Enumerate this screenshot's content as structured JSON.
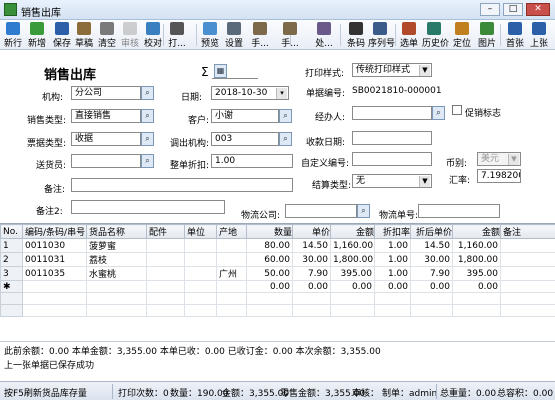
{
  "window": {
    "title": "销售出库",
    "btn_min": "–",
    "btn_max": "□",
    "btn_close": "✕"
  },
  "toolbar": [
    {
      "name": "new-row",
      "label": "新行",
      "icon": "new-row-icon"
    },
    {
      "name": "new",
      "label": "新增",
      "icon": "new-doc-icon"
    },
    {
      "name": "save",
      "label": "保存",
      "icon": "save-icon"
    },
    {
      "name": "draft",
      "label": "草稿",
      "icon": "draft-icon"
    },
    {
      "name": "clear",
      "label": "清空",
      "icon": "clear-icon"
    },
    {
      "name": "audit",
      "label": "审核",
      "icon": "audit-icon",
      "disabled": true
    },
    {
      "name": "proof",
      "label": "校对",
      "icon": "proof-icon"
    },
    {
      "name": "print",
      "label": "打...",
      "icon": "print-icon"
    },
    {
      "name": "preview",
      "label": "预览",
      "icon": "preview-icon"
    },
    {
      "name": "settings",
      "label": "设置",
      "icon": "settings-icon"
    },
    {
      "name": "hand",
      "label": "手...",
      "icon": "hand-icon"
    },
    {
      "name": "hand2",
      "label": "手...",
      "icon": "hand2-icon"
    },
    {
      "name": "process",
      "label": "处...",
      "icon": "process-icon"
    },
    {
      "name": "barcode",
      "label": "条码",
      "icon": "barcode-icon"
    },
    {
      "name": "serial",
      "label": "序列号",
      "icon": "serial-icon"
    },
    {
      "name": "select-order",
      "label": "选单",
      "icon": "select-order-icon"
    },
    {
      "name": "history-price",
      "label": "历史价",
      "icon": "history-price-icon"
    },
    {
      "name": "locate",
      "label": "定位",
      "icon": "locate-icon"
    },
    {
      "name": "picture",
      "label": "图片",
      "icon": "picture-icon"
    },
    {
      "name": "first",
      "label": "首张",
      "icon": "first-icon"
    },
    {
      "name": "prev",
      "label": "上张",
      "icon": "prev-icon"
    }
  ],
  "form": {
    "heading": "销售出库",
    "sigma": "Σ",
    "print_style_label": "打印样式:",
    "print_style_value": "传统打印样式",
    "org_label": "机构:",
    "org_value": "分公司",
    "date_label": "日期:",
    "date_value": "2018-10-30",
    "doc_no_label": "单据编号:",
    "doc_no_value": "SB0021810-000001",
    "sales_type_label": "销售类型:",
    "sales_type_value": "直接销售",
    "customer_label": "客户:",
    "customer_value": "小谢",
    "handler_label": "经办人:",
    "handler_value": "",
    "promo_label": "促销标志",
    "bill_type_label": "票据类型:",
    "bill_type_value": "收据",
    "transfer_org_label": "调出机构:",
    "transfer_org_value": "003",
    "due_date_label": "收款日期:",
    "due_date_value": "",
    "courier_label": "送货员:",
    "courier_value": "",
    "discount_label": "整单折扣:",
    "discount_value": "1.00",
    "custom_no_label": "自定义编号:",
    "custom_no_value": "",
    "currency_label": "币别:",
    "currency_value": "美元",
    "rate_label": "汇率:",
    "rate_value": "7.198200",
    "remark_label": "备注:",
    "remark_value": "",
    "settle_label": "结算类型:",
    "settle_value": "无",
    "remark2_label": "备注2:",
    "remark2_value": "",
    "logistics_label": "物流公司:",
    "logistics_value": "",
    "logistics_no_label": "物流单号:",
    "logistics_no_value": ""
  },
  "grid": {
    "columns": [
      "No.",
      "编码/条码/串号",
      "货品名称",
      "配件",
      "单位",
      "产地",
      "数量",
      "单价",
      "金额",
      "折扣率",
      "折后单价",
      "金额",
      "备注"
    ],
    "rows": [
      [
        "1",
        "0011030",
        "菠萝蜜",
        "",
        "",
        "",
        "80.00",
        "14.50",
        "1,160.00",
        "1.00",
        "14.50",
        "1,160.00",
        ""
      ],
      [
        "2",
        "0011031",
        "荔枝",
        "",
        "",
        "",
        "60.00",
        "30.00",
        "1,800.00",
        "1.00",
        "30.00",
        "1,800.00",
        ""
      ],
      [
        "3",
        "0011035",
        "水蜜桃",
        "",
        "",
        "广州",
        "50.00",
        "7.90",
        "395.00",
        "1.00",
        "7.90",
        "395.00",
        ""
      ],
      [
        "✱",
        "",
        "",
        "",
        "",
        "",
        "0.00",
        "0.00",
        "0.00",
        "0.00",
        "0.00",
        "0.00",
        ""
      ]
    ]
  },
  "summary": {
    "line1": "此前余额：0.00  本单金额：3,355.00  本单已收：0.00  已收订金：0.00  本次余额：3,355.00",
    "line2": "上一张单据已保存成功"
  },
  "status": {
    "s1": "按F5刷新货品库存量",
    "s2": "打印次数：0",
    "s3": "数量：190.00",
    "s4": "金额：3,355.00",
    "s5": "零售金额：3,355.00",
    "s6": "审核：",
    "s7": "制单：admin",
    "s8": "总重量：0.00",
    "s9": "总容积：0.00"
  },
  "colors": {
    "accent": "#3a6ea5",
    "titlebar": "#d4e2f3"
  }
}
